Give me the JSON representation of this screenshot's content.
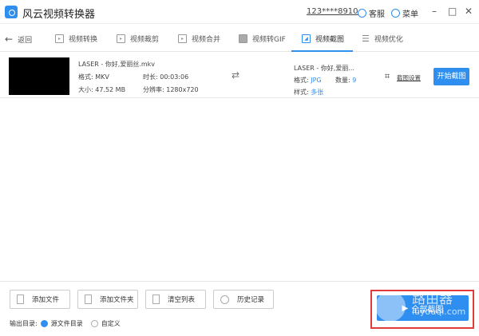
{
  "app": {
    "title": "风云视频转换器",
    "account": "123****8910",
    "service": "客服",
    "menu": "菜单",
    "minimize": "–",
    "maximize": "□",
    "close": "✕"
  },
  "nav": {
    "back": "返回",
    "tabs": [
      {
        "label": "视频转换"
      },
      {
        "label": "视频裁剪"
      },
      {
        "label": "视频合并"
      },
      {
        "label": "视频转GIF"
      },
      {
        "label": "视频截图"
      },
      {
        "label": "视频优化"
      }
    ],
    "active": "视频截图"
  },
  "file": {
    "name": "LASER - 你好,爱丽丝.mkv",
    "format": "格式: MKV",
    "duration": "时长: 00:03:06",
    "size": "大小: 47.52 MB",
    "resolution": "分辨率: 1280x720",
    "out_name": "LASER - 你好,爱丽...",
    "out_format_label": "格式:",
    "out_format": "JPG",
    "count_label": "数量:",
    "count": "9",
    "style_label": "样式:",
    "style": "多张",
    "settings": "截图设置",
    "start": "开始截图"
  },
  "bottom": {
    "add_file": "添加文件",
    "add_folder": "添加文件夹",
    "clear": "清空列表",
    "history": "历史记录",
    "output_label": "输出目录:",
    "opt_source": "源文件目录",
    "opt_custom": "自定义",
    "all": "全部截图"
  },
  "watermark": {
    "text": "路由器",
    "url": "luyouqi.com"
  },
  "colors": {
    "accent": "#2f8ff0",
    "highlight": "#e23b3b"
  }
}
